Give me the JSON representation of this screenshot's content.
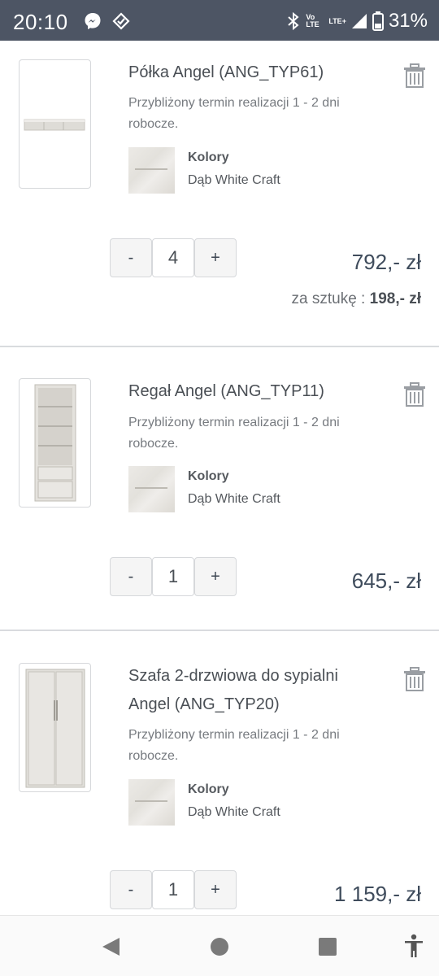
{
  "status_bar": {
    "time": "20:10",
    "left_icons": [
      "messenger-icon",
      "check-badge-icon"
    ],
    "right_icons": [
      "bluetooth-icon",
      "volte-icon",
      "lte-signal-icon",
      "battery-icon"
    ],
    "volte_label": "Vo LTE",
    "lte_label": "LTE+",
    "battery": "31%"
  },
  "cart": {
    "lead_time": "Przybliżony termin realizacji 1 - 2 dni robocze.",
    "colors_label": "Kolory",
    "items": [
      {
        "title": "Półka Angel (ANG_TYP61)",
        "color": "Dąb White Craft",
        "quantity": "4",
        "price": "792,- zł",
        "unit_price_label": "za sztukę :",
        "unit_price": "198,- zł"
      },
      {
        "title": "Regał Angel (ANG_TYP11)",
        "color": "Dąb White Craft",
        "quantity": "1",
        "price": "645,- zł"
      },
      {
        "title": "Szafa 2-drzwiowa do sypialni Angel (ANG_TYP20)",
        "color": "Dąb White Craft",
        "quantity": "1",
        "price": "1 159,- zł"
      }
    ],
    "minus_label": "-",
    "plus_label": "+"
  },
  "nav_bar": {
    "icons": [
      "back-icon",
      "home-icon",
      "recents-icon",
      "accessibility-icon"
    ]
  }
}
